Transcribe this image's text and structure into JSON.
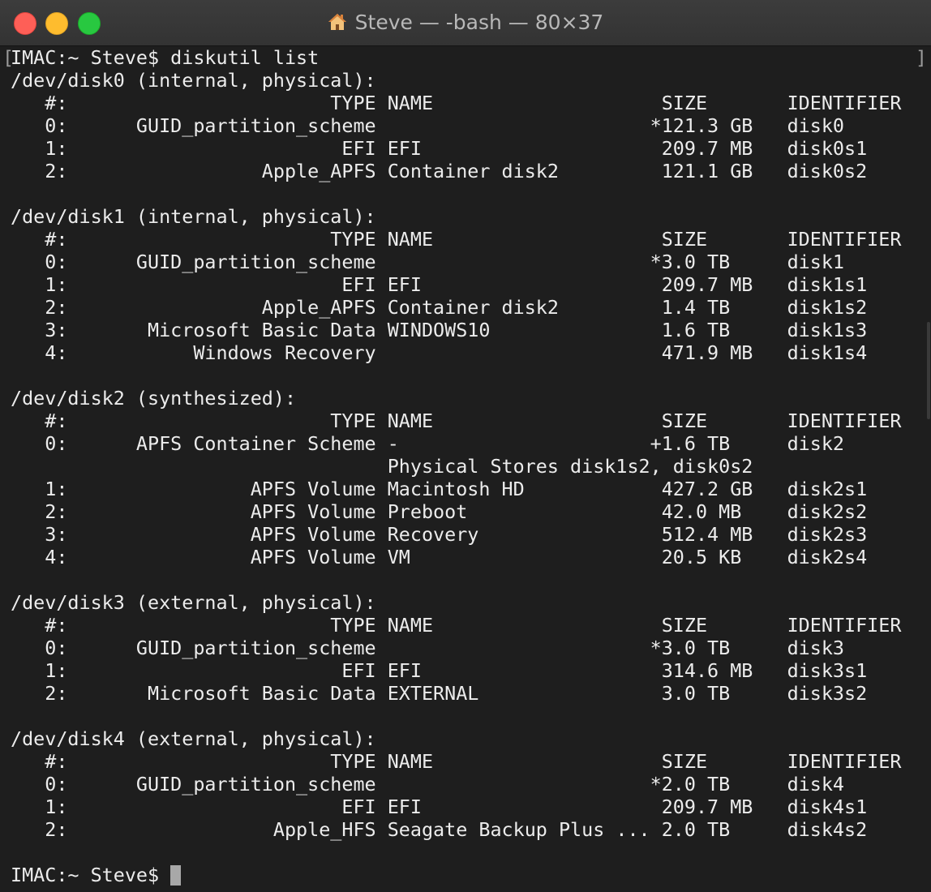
{
  "window": {
    "title": "Steve — -bash — 80×37",
    "title_icon": "home-folder-icon"
  },
  "terminal": {
    "lines": [
      "IMAC:~ Steve$ diskutil list",
      "/dev/disk0 (internal, physical):",
      "   #:                       TYPE NAME                    SIZE       IDENTIFIER",
      "   0:      GUID_partition_scheme                        *121.3 GB   disk0",
      "   1:                        EFI EFI                     209.7 MB   disk0s1",
      "   2:                 Apple_APFS Container disk2         121.1 GB   disk0s2",
      "",
      "/dev/disk1 (internal, physical):",
      "   #:                       TYPE NAME                    SIZE       IDENTIFIER",
      "   0:      GUID_partition_scheme                        *3.0 TB     disk1",
      "   1:                        EFI EFI                     209.7 MB   disk1s1",
      "   2:                 Apple_APFS Container disk2         1.4 TB     disk1s2",
      "   3:       Microsoft Basic Data WINDOWS10               1.6 TB     disk1s3",
      "   4:           Windows Recovery                         471.9 MB   disk1s4",
      "",
      "/dev/disk2 (synthesized):",
      "   #:                       TYPE NAME                    SIZE       IDENTIFIER",
      "   0:      APFS Container Scheme -                      +1.6 TB     disk2",
      "                                 Physical Stores disk1s2, disk0s2",
      "   1:                APFS Volume Macintosh HD            427.2 GB   disk2s1",
      "   2:                APFS Volume Preboot                 42.0 MB    disk2s2",
      "   3:                APFS Volume Recovery                512.4 MB   disk2s3",
      "   4:                APFS Volume VM                      20.5 KB    disk2s4",
      "",
      "/dev/disk3 (external, physical):",
      "   #:                       TYPE NAME                    SIZE       IDENTIFIER",
      "   0:      GUID_partition_scheme                        *3.0 TB     disk3",
      "   1:                        EFI EFI                     314.6 MB   disk3s1",
      "   2:       Microsoft Basic Data EXTERNAL                3.0 TB     disk3s2",
      "",
      "/dev/disk4 (external, physical):",
      "   #:                       TYPE NAME                    SIZE       IDENTIFIER",
      "   0:      GUID_partition_scheme                        *2.0 TB     disk4",
      "   1:                        EFI EFI                     209.7 MB   disk4s1",
      "   2:                  Apple_HFS Seagate Backup Plus ... 2.0 TB     disk4s2",
      ""
    ],
    "prompt": "IMAC:~ Steve$ ",
    "bracket_left": "[",
    "bracket_right": "]"
  }
}
